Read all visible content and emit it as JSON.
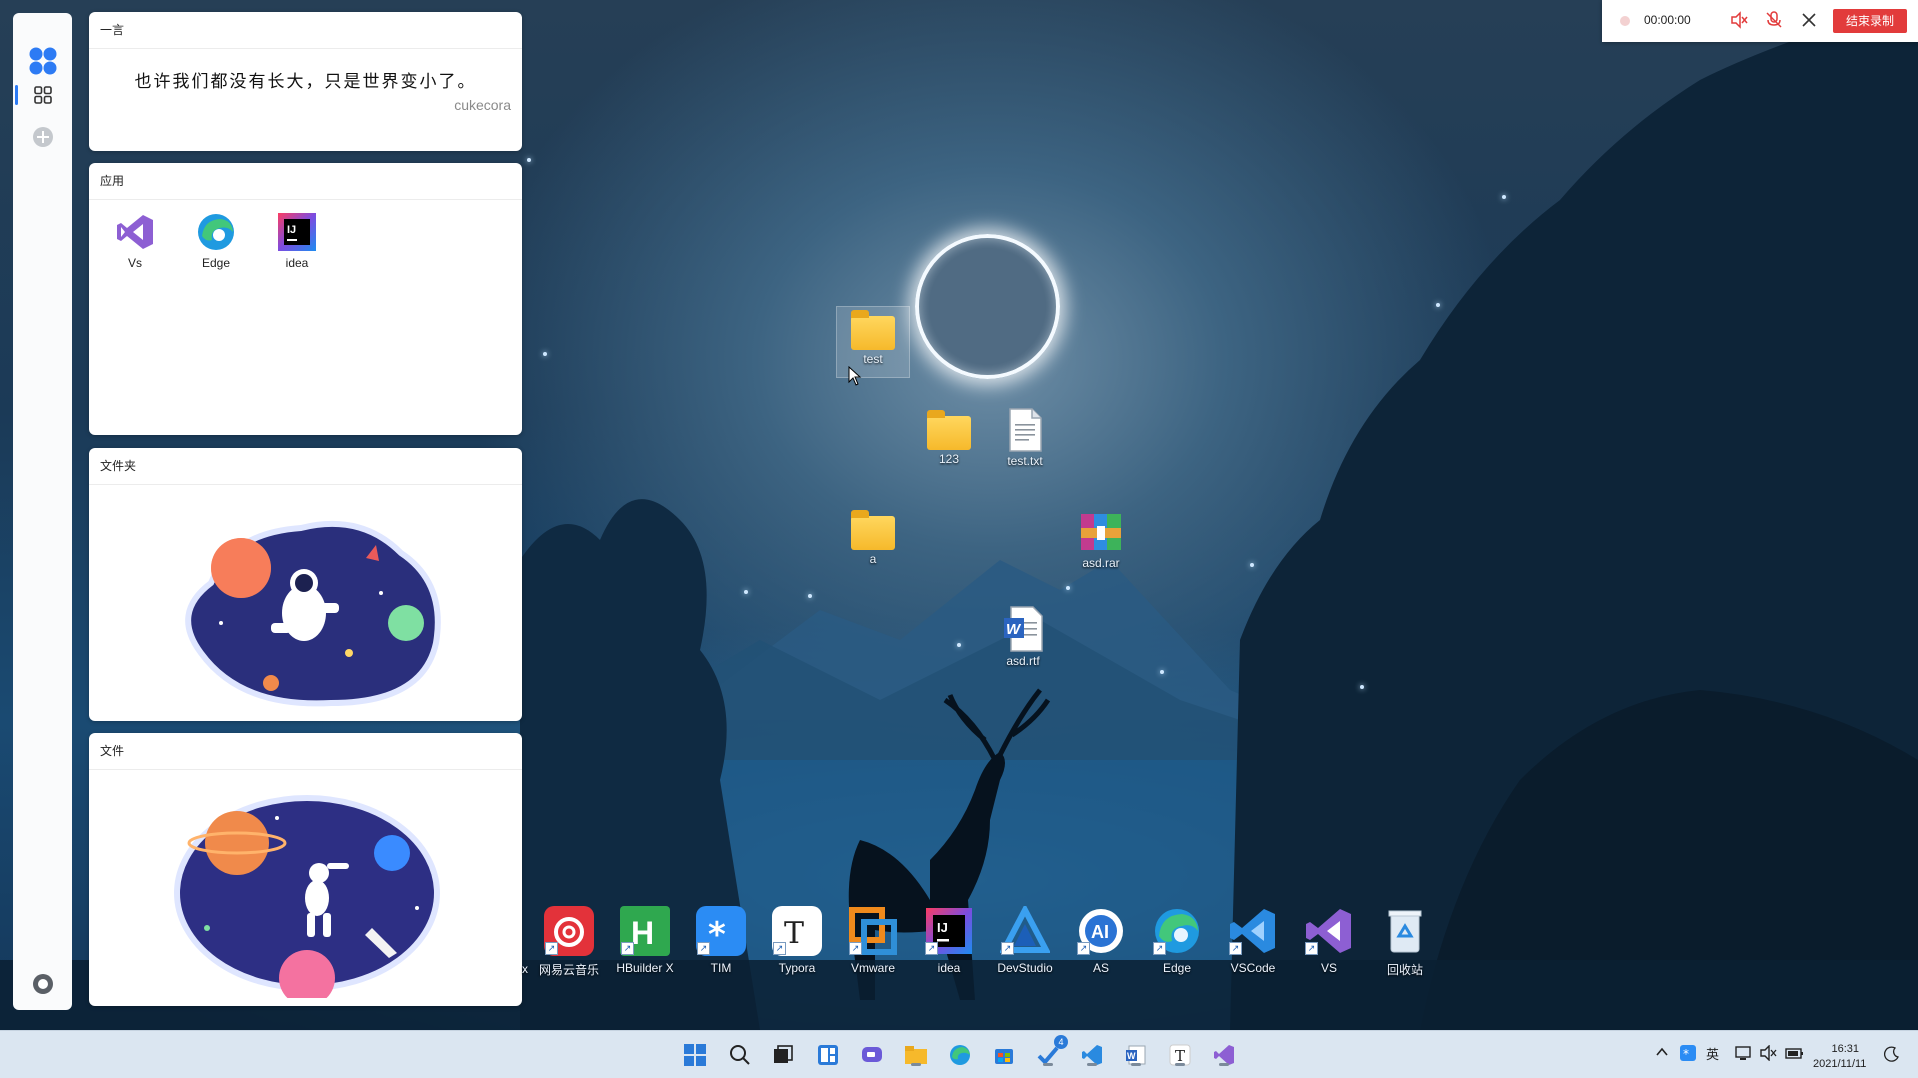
{
  "quote_card": {
    "title": "一言",
    "text": "也许我们都没有长大，只是世界变小了。",
    "author": "cukecora"
  },
  "apps_card": {
    "title": "应用",
    "apps": [
      {
        "label": "Vs",
        "icon": "visual-studio-icon"
      },
      {
        "label": "Edge",
        "icon": "edge-icon"
      },
      {
        "label": "idea",
        "icon": "intellij-idea-icon"
      }
    ]
  },
  "folder_card": {
    "title": "文件夹"
  },
  "file_card": {
    "title": "文件"
  },
  "desktop_icons": [
    {
      "label": "test",
      "type": "folder"
    },
    {
      "label": "123",
      "type": "folder"
    },
    {
      "label": "test.txt",
      "type": "text-file"
    },
    {
      "label": "a",
      "type": "folder"
    },
    {
      "label": "asd.rar",
      "type": "archive"
    },
    {
      "label": "asd.rtf",
      "type": "word-document"
    }
  ],
  "dock": [
    {
      "label": "网易云音乐",
      "icon": "netease-music-icon"
    },
    {
      "label": "HBuilder X",
      "icon": "hbuilderx-icon"
    },
    {
      "label": "TIM",
      "icon": "tim-icon"
    },
    {
      "label": "Typora",
      "icon": "typora-icon"
    },
    {
      "label": "Vmware",
      "icon": "vmware-icon"
    },
    {
      "label": "idea",
      "icon": "intellij-idea-icon"
    },
    {
      "label": "DevStudio",
      "icon": "devstudio-icon"
    },
    {
      "label": "AS",
      "icon": "android-studio-icon"
    },
    {
      "label": "Edge",
      "icon": "edge-icon"
    },
    {
      "label": "VSCode",
      "icon": "vscode-icon"
    },
    {
      "label": "VS",
      "icon": "visual-studio-icon"
    },
    {
      "label": "回收站",
      "icon": "recycle-bin-icon"
    }
  ],
  "recording": {
    "timer": "00:00:00",
    "end_label": "结束录制"
  },
  "taskbar": {
    "badge_count": "4",
    "ime_label": "英",
    "time": "16:31",
    "date": "2021/11/11"
  },
  "colors": {
    "accent": "#2d7bf4",
    "end_button": "#e23b3b",
    "taskbar": "#dbe6f1"
  }
}
